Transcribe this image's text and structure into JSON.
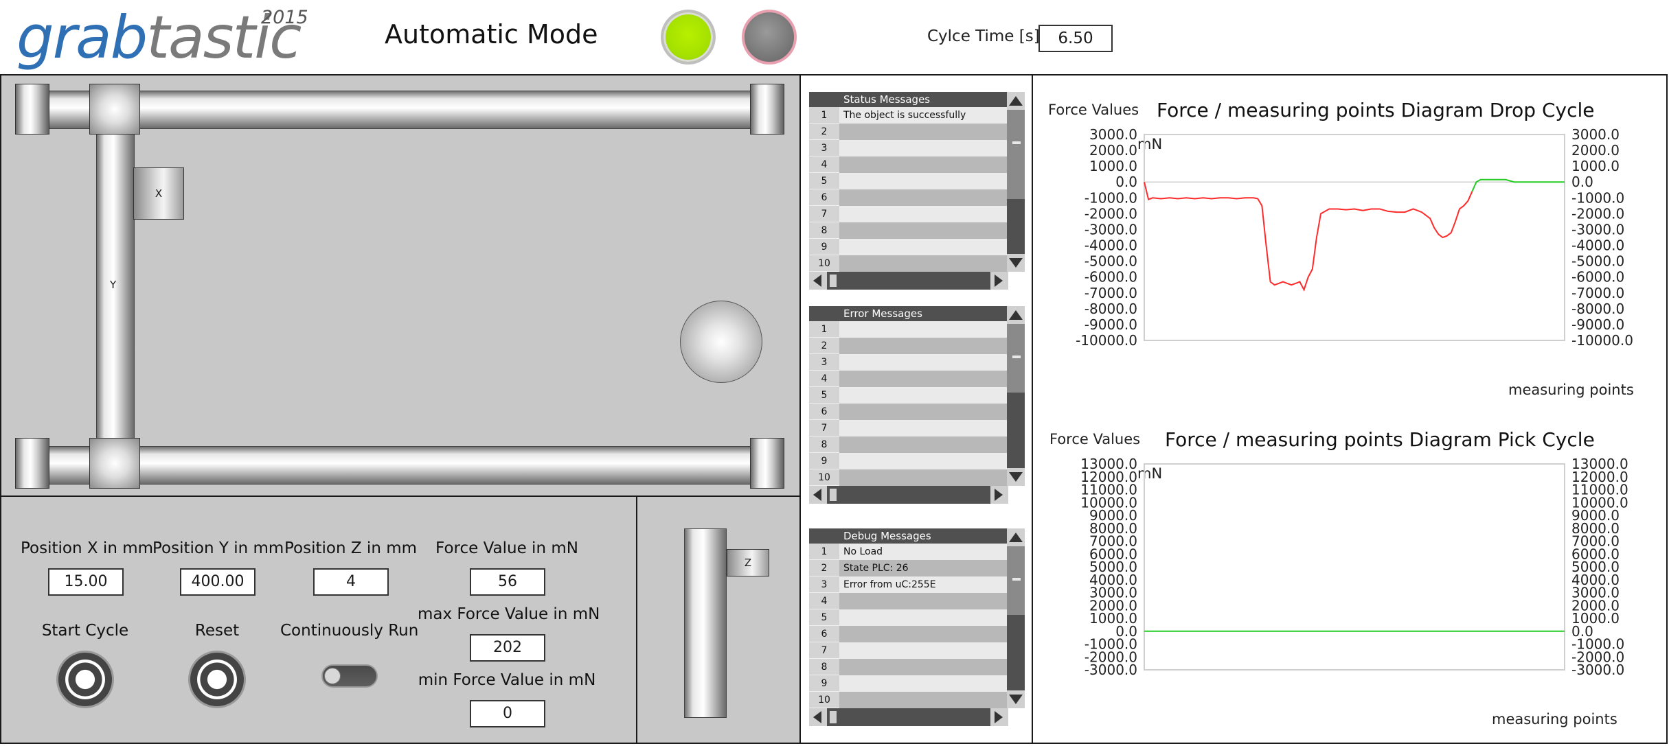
{
  "header": {
    "logo_text_a": "grab",
    "logo_text_b": "tastic",
    "logo_year": "2015",
    "mode_title": "Automatic Mode",
    "cycle_time_label": "Cylce Time [s]:",
    "cycle_time_value": "6.50",
    "status_led_colors": [
      "#a4e000",
      "#7a7a7a"
    ]
  },
  "gantry": {
    "x_label": "X",
    "y_label": "Y",
    "z_label": "Z"
  },
  "controls": {
    "pos_x_label": "Position X in mm",
    "pos_x_value": "15.00",
    "pos_y_label": "Position Y in mm",
    "pos_y_value": "400.00",
    "pos_z_label": "Position Z in mm",
    "pos_z_value": "4",
    "force_label": "Force Value in mN",
    "force_value": "56",
    "max_force_label": "max Force Value in mN",
    "max_force_value": "202",
    "min_force_label": "min Force Value in mN",
    "min_force_value": "0",
    "start_label": "Start Cycle",
    "reset_label": "Reset",
    "continuous_label": "Continuously Run"
  },
  "messages": {
    "status": {
      "title": "Status Messages",
      "rows": [
        {
          "n": "1",
          "text": "The object is successfully dropped"
        },
        {
          "n": "2",
          "text": ""
        },
        {
          "n": "3",
          "text": ""
        },
        {
          "n": "4",
          "text": ""
        },
        {
          "n": "5",
          "text": ""
        },
        {
          "n": "6",
          "text": ""
        },
        {
          "n": "7",
          "text": ""
        },
        {
          "n": "8",
          "text": ""
        },
        {
          "n": "9",
          "text": ""
        },
        {
          "n": "10",
          "text": ""
        }
      ]
    },
    "error": {
      "title": "Error Messages",
      "rows": [
        {
          "n": "1",
          "text": ""
        },
        {
          "n": "2",
          "text": ""
        },
        {
          "n": "3",
          "text": ""
        },
        {
          "n": "4",
          "text": ""
        },
        {
          "n": "5",
          "text": ""
        },
        {
          "n": "6",
          "text": ""
        },
        {
          "n": "7",
          "text": ""
        },
        {
          "n": "8",
          "text": ""
        },
        {
          "n": "9",
          "text": ""
        },
        {
          "n": "10",
          "text": ""
        }
      ]
    },
    "debug": {
      "title": "Debug Messages",
      "rows": [
        {
          "n": "1",
          "text": "No Load"
        },
        {
          "n": "2",
          "text": "State PLC: 26"
        },
        {
          "n": "3",
          "text": "Error from uC:255E"
        },
        {
          "n": "4",
          "text": ""
        },
        {
          "n": "5",
          "text": ""
        },
        {
          "n": "6",
          "text": ""
        },
        {
          "n": "7",
          "text": ""
        },
        {
          "n": "8",
          "text": ""
        },
        {
          "n": "9",
          "text": ""
        },
        {
          "n": "10",
          "text": ""
        }
      ]
    }
  },
  "chart_data": [
    {
      "type": "line",
      "title": "Force / measuring points Diagram Drop Cycle",
      "ylabel": "Force Values",
      "unit": "mN",
      "xlabel": "measuring points",
      "ylim": [
        -10000,
        3000
      ],
      "yticks": [
        "3000.0",
        "2000.0",
        "1000.0",
        "0.0",
        "-1000.0",
        "-2000.0",
        "-3000.0",
        "-4000.0",
        "-5000.0",
        "-6000.0",
        "-7000.0",
        "-8000.0",
        "-9000.0",
        "-10000.0"
      ],
      "xlim": [
        0,
        100
      ],
      "grid": false,
      "series": [
        {
          "color": "#ff2a2a",
          "x": [
            0,
            1,
            2,
            4,
            6,
            8,
            10,
            12,
            14,
            16,
            18,
            20,
            22,
            24,
            26,
            27,
            28,
            29,
            30,
            31,
            32,
            33,
            34,
            35,
            36,
            37,
            38,
            39,
            40,
            41,
            42,
            44,
            46,
            48,
            50,
            52,
            54,
            56,
            58,
            60,
            62,
            64,
            66,
            68,
            69,
            70,
            71,
            72,
            73,
            74,
            75,
            76,
            77,
            78
          ],
          "y": [
            0,
            -1100,
            -1000,
            -1050,
            -1000,
            -1050,
            -1000,
            -1050,
            -1000,
            -1050,
            -1000,
            -1000,
            -1050,
            -1000,
            -1000,
            -1050,
            -1500,
            -4000,
            -6300,
            -6500,
            -6400,
            -6300,
            -6400,
            -6500,
            -6400,
            -6300,
            -6800,
            -6000,
            -5500,
            -3500,
            -2000,
            -1700,
            -1700,
            -1750,
            -1700,
            -1800,
            -1700,
            -1700,
            -1850,
            -1900,
            -1900,
            -1700,
            -1900,
            -2300,
            -2900,
            -3300,
            -3500,
            -3400,
            -3200,
            -2500,
            -1700,
            -1500,
            -1200,
            -600
          ]
        },
        {
          "color": "#22cc22",
          "x": [
            78,
            79,
            80,
            82,
            84,
            86,
            88,
            90,
            92,
            94,
            96,
            98,
            100
          ],
          "y": [
            -600,
            0,
            150,
            150,
            150,
            150,
            0,
            0,
            0,
            0,
            0,
            0,
            0
          ]
        }
      ]
    },
    {
      "type": "line",
      "title": "Force / measuring points Diagram Pick Cycle",
      "ylabel": "Force Values",
      "unit": "mN",
      "xlabel": "measuring points",
      "ylim": [
        -3000,
        13000
      ],
      "yticks": [
        "13000.0",
        "12000.0",
        "11000.0",
        "10000.0",
        "9000.0",
        "8000.0",
        "7000.0",
        "6000.0",
        "5000.0",
        "4000.0",
        "3000.0",
        "2000.0",
        "1000.0",
        "0.0",
        "-1000.0",
        "-2000.0",
        "-3000.0"
      ],
      "xlim": [
        0,
        100
      ],
      "grid": false,
      "series": [
        {
          "color": "#22cc22",
          "x": [
            0,
            100
          ],
          "y": [
            0,
            0
          ]
        }
      ]
    }
  ]
}
